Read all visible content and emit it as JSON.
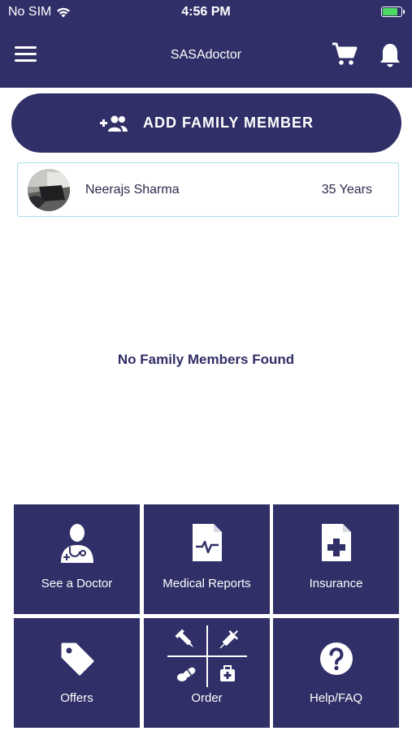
{
  "status_bar": {
    "carrier": "No SIM",
    "time": "4:56 PM",
    "battery_level": 0.85
  },
  "header": {
    "title": "SASAdoctor"
  },
  "add_member": {
    "label": "ADD FAMILY MEMBER"
  },
  "member": {
    "name": "Neerajs Sharma",
    "age": "35 Years"
  },
  "empty_message": "No Family Members Found",
  "tiles": [
    {
      "label": "See a Doctor",
      "icon": "doctor-icon"
    },
    {
      "label": "Medical Reports",
      "icon": "medical-report-icon"
    },
    {
      "label": "Insurance",
      "icon": "insurance-icon"
    },
    {
      "label": "Offers",
      "icon": "tag-icon"
    },
    {
      "label": "Order",
      "icon": "order-icon"
    },
    {
      "label": "Help/FAQ",
      "icon": "help-icon"
    }
  ],
  "colors": {
    "primary": "#302f67",
    "card_border": "#a9dfe8",
    "battery": "#4cd964"
  }
}
